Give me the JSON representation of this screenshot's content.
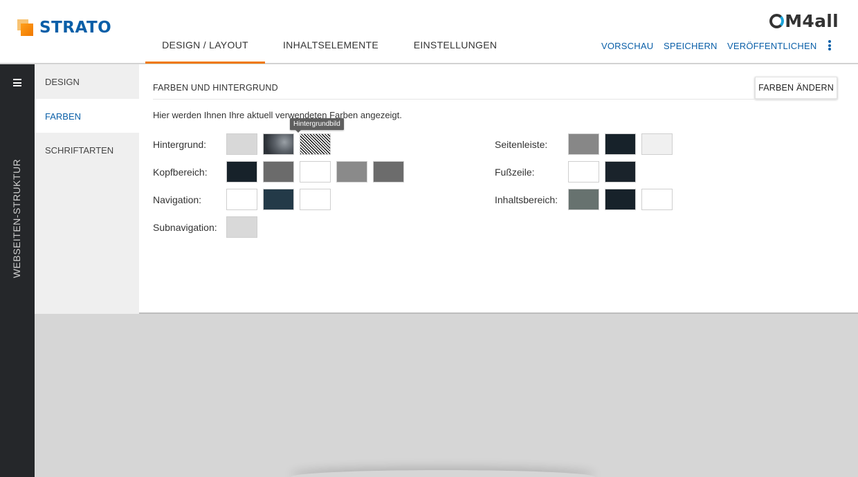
{
  "header": {
    "brand": "STRATO",
    "partner_logo": "M4all",
    "tabs": [
      {
        "label": "DESIGN / LAYOUT",
        "active": true
      },
      {
        "label": "INHALTSELEMENTE",
        "active": false
      },
      {
        "label": "EINSTELLUNGEN",
        "active": false
      }
    ],
    "actions": {
      "preview": "VORSCHAU",
      "save": "SPEICHERN",
      "publish": "VERÖFFENTLICHEN",
      "more_icon": "more-vertical-icon"
    }
  },
  "rail": {
    "menu_icon": "hamburger-icon",
    "label": "WEBSEITEN-STRUKTUR"
  },
  "subnav": {
    "items": [
      {
        "label": "DESIGN",
        "active": false
      },
      {
        "label": "FARBEN",
        "active": true
      },
      {
        "label": "SCHRIFTARTEN",
        "active": false
      }
    ]
  },
  "panel": {
    "title": "FARBEN UND HINTERGRUND",
    "change_button": "FARBEN ÄNDERN",
    "description": "Hier werden Ihnen Ihre aktuell verwendeten Farben angezeigt.",
    "tooltip": "Hintergrundbild",
    "left_groups": [
      {
        "label": "Hintergrund:",
        "swatches": [
          "#d8d8d8",
          "image-noise",
          "pattern-hatch"
        ]
      },
      {
        "label": "Kopfbereich:",
        "swatches": [
          "#17222a",
          "#6b6b6b",
          "#ffffff",
          "#8a8a8a",
          "#6c6c6c"
        ]
      },
      {
        "label": "Navigation:",
        "swatches": [
          "#ffffff",
          "#233a48",
          "#ffffff"
        ]
      },
      {
        "label": "Subnavigation:",
        "swatches": [
          "#d9d9d9"
        ]
      }
    ],
    "right_groups": [
      {
        "label": "Seitenleiste:",
        "swatches": [
          "#878787",
          "#17222a",
          "#f0f0f0"
        ]
      },
      {
        "label": "Fußzeile:",
        "swatches": [
          "#ffffff",
          "#1a232b"
        ]
      },
      {
        "label": "Inhaltsbereich:",
        "swatches": [
          "#67726f",
          "#17222a",
          "#ffffff"
        ]
      }
    ]
  },
  "colors": {
    "accent": "#f07800",
    "link": "#0a5fa8",
    "rail": "#25272a"
  }
}
